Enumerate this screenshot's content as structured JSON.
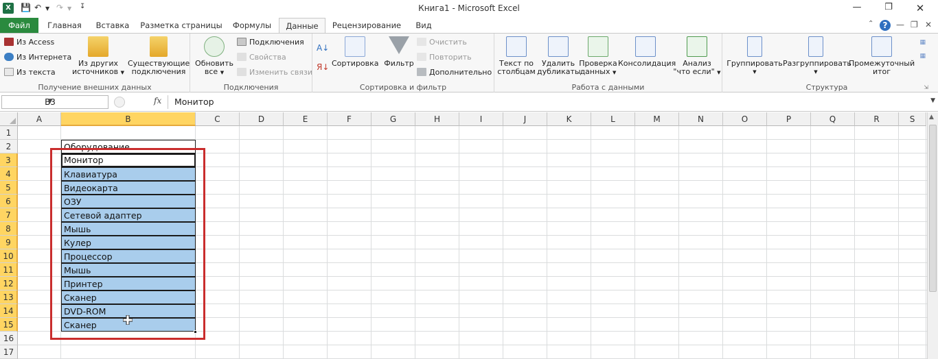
{
  "window": {
    "title": "Книга1  -  Microsoft Excel",
    "app_icon": "X"
  },
  "tabs": [
    {
      "label": "Файл"
    },
    {
      "label": "Главная"
    },
    {
      "label": "Вставка"
    },
    {
      "label": "Разметка страницы"
    },
    {
      "label": "Формулы"
    },
    {
      "label": "Данные"
    },
    {
      "label": "Рецензирование"
    },
    {
      "label": "Вид"
    }
  ],
  "active_tab": "Данные",
  "ribbon": {
    "get_external": {
      "label": "Получение внешних данных",
      "from_access": "Из Access",
      "from_web": "Из Интернета",
      "from_text": "Из текста",
      "from_other_l1": "Из других",
      "from_other_l2": "источников",
      "existing_l1": "Существующие",
      "existing_l2": "подключения"
    },
    "connections": {
      "label": "Подключения",
      "refresh_l1": "Обновить",
      "refresh_l2": "все",
      "connections": "Подключения",
      "properties": "Свойства",
      "edit_links": "Изменить связи"
    },
    "sort_filter": {
      "label": "Сортировка и фильтр",
      "sort": "Сортировка",
      "filter": "Фильтр",
      "clear": "Очистить",
      "reapply": "Повторить",
      "advanced": "Дополнительно"
    },
    "data_tools": {
      "label": "Работа с данными",
      "text_to_cols_l1": "Текст по",
      "text_to_cols_l2": "столбцам",
      "remove_dup_l1": "Удалить",
      "remove_dup_l2": "дубликаты",
      "validation_l1": "Проверка",
      "validation_l2": "данных",
      "consolidate": "Консолидация",
      "whatif_l1": "Анализ",
      "whatif_l2": "\"что если\""
    },
    "outline": {
      "label": "Структура",
      "group": "Группировать",
      "ungroup": "Разгруппировать",
      "subtotal_l1": "Промежуточный",
      "subtotal_l2": "итог"
    }
  },
  "formula_bar": {
    "name_box": "B3",
    "fx": "fx",
    "value": "Монитор"
  },
  "columns": [
    "A",
    "B",
    "C",
    "D",
    "E",
    "F",
    "G",
    "H",
    "I",
    "J",
    "K",
    "L",
    "M",
    "N",
    "O",
    "P",
    "Q",
    "R",
    "S"
  ],
  "rows": [
    "1",
    "2",
    "3",
    "4",
    "5",
    "6",
    "7",
    "8",
    "9",
    "10",
    "11",
    "12",
    "13",
    "14",
    "15",
    "16",
    "17"
  ],
  "cells": {
    "B2": "Оборудование",
    "list": [
      "Монитор",
      "Клавиатура",
      "Видеокарта",
      "ОЗУ",
      "Сетевой адаптер",
      "Мышь",
      "Кулер",
      "Процессор",
      "Мышь",
      "Принтер",
      "Сканер",
      "DVD-ROM",
      "Сканер"
    ]
  },
  "colors": {
    "file_tab": "#2a8a3e",
    "selection_fill": "#a9cdec",
    "header_highlight": "#ffd562",
    "annotation_frame": "#c92d2d"
  }
}
